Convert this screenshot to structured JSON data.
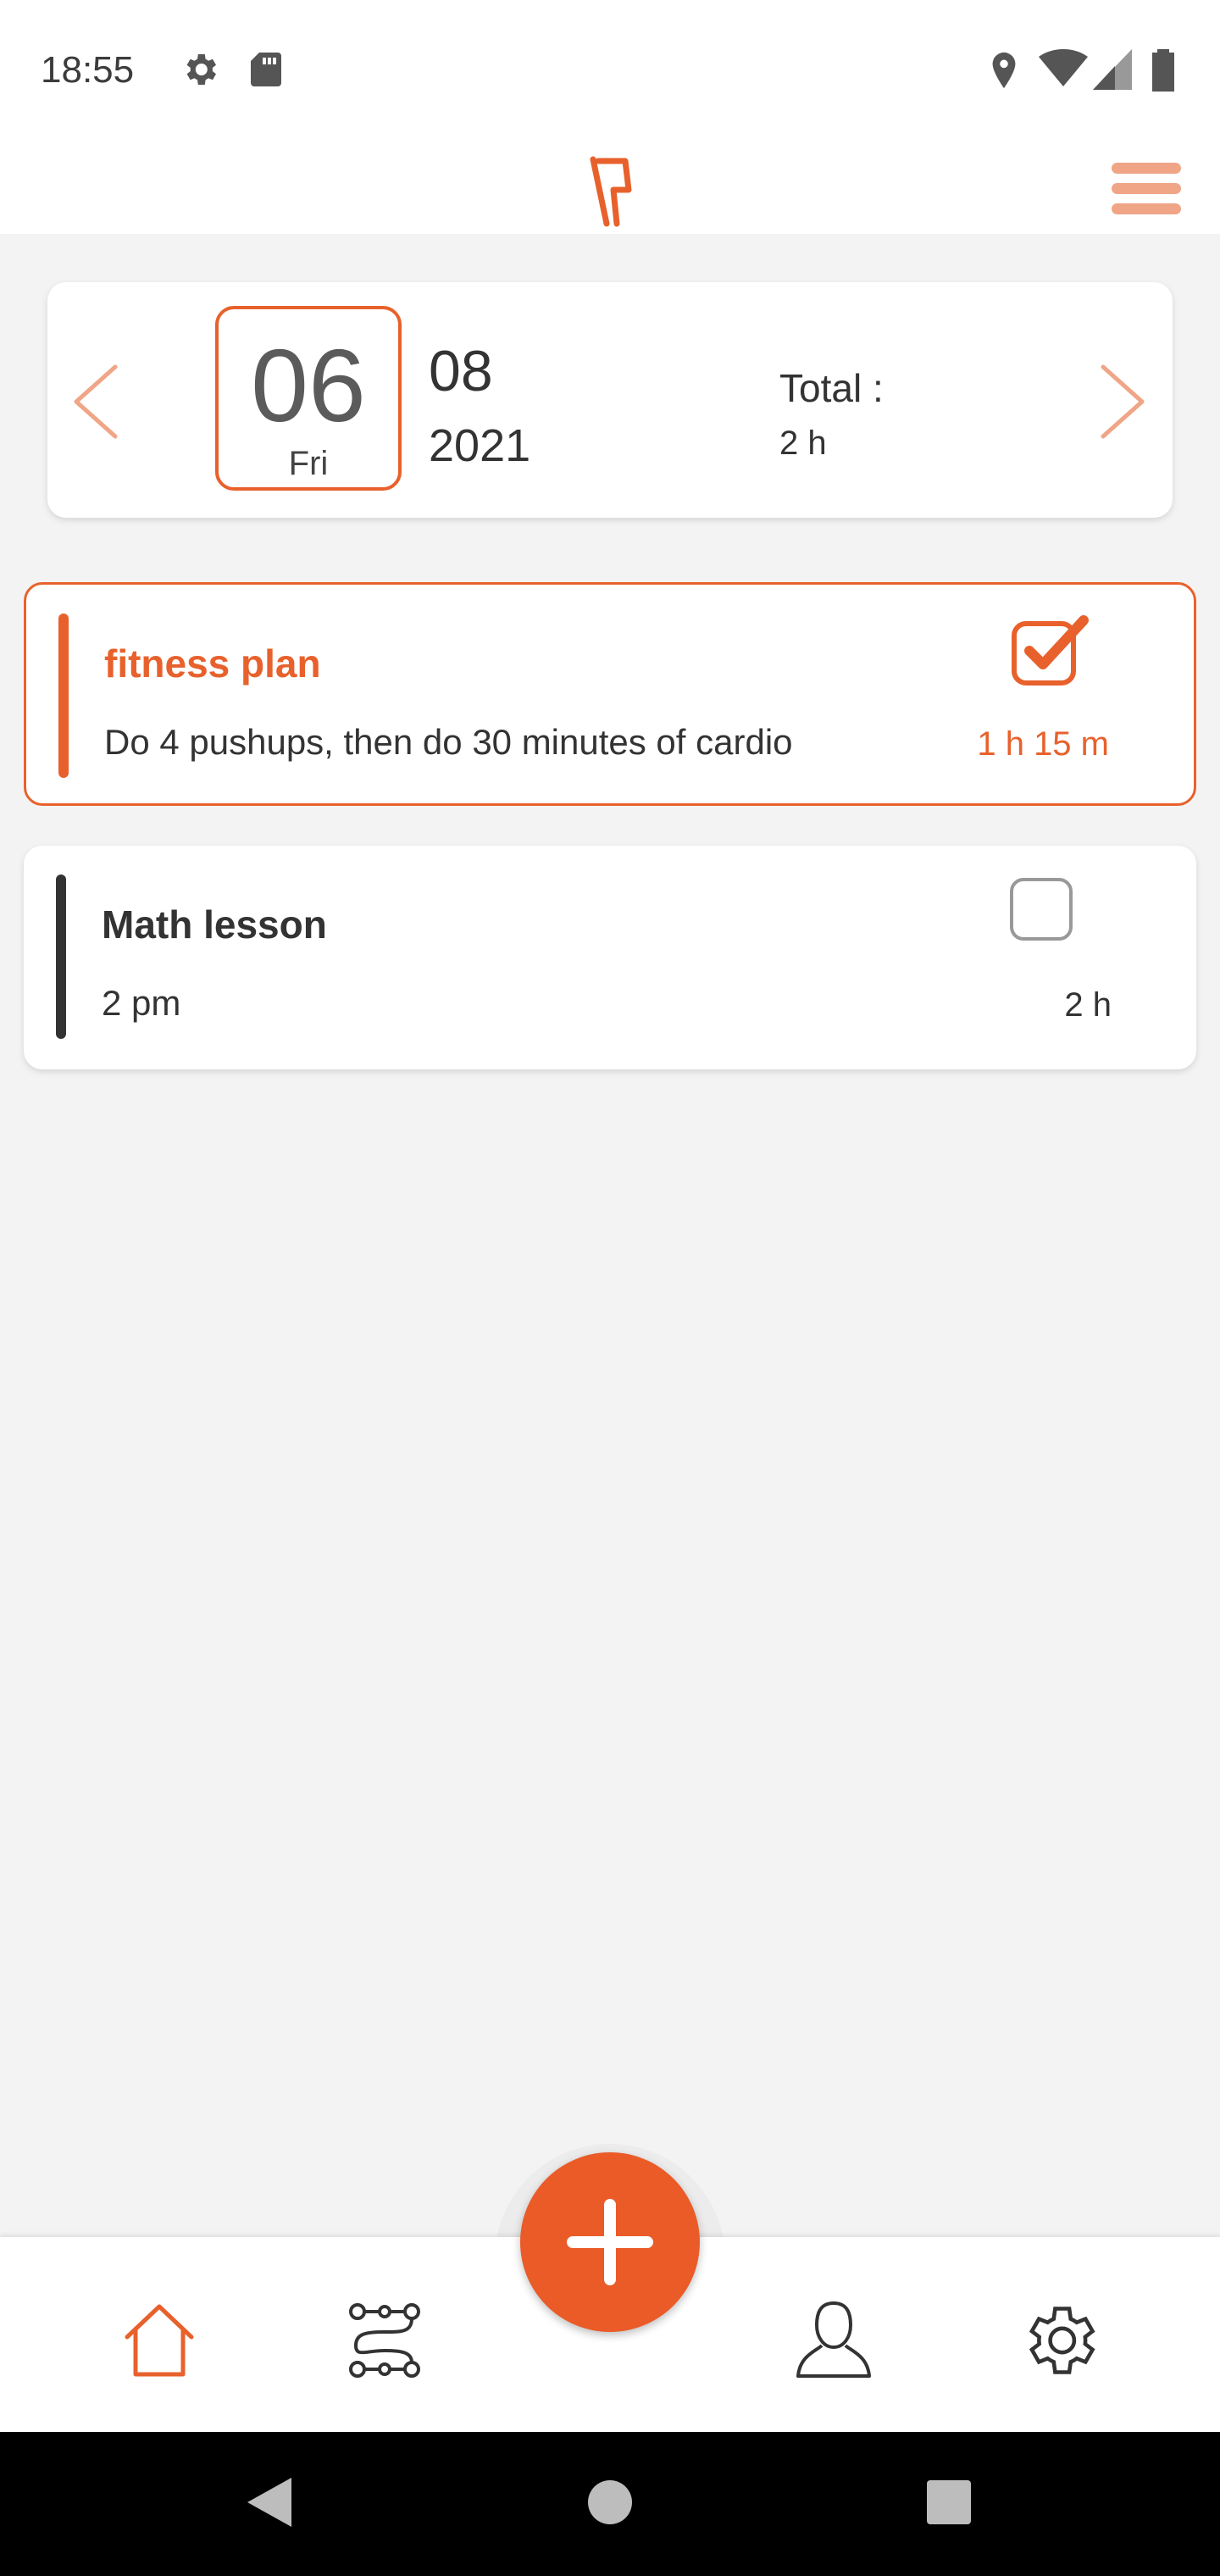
{
  "status_bar": {
    "time": "18:55",
    "left_icons": [
      "gear-icon",
      "sd-card-icon"
    ],
    "right_icons": [
      "location-icon",
      "wifi-icon",
      "signal-icon",
      "battery-icon"
    ]
  },
  "header": {
    "logo": "app-logo",
    "menu_icon": "hamburger-menu-icon"
  },
  "date_selector": {
    "day_number": "06",
    "day_name": "Fri",
    "month": "08",
    "year": "2021",
    "total_label": "Total :",
    "total_value": "2 h",
    "prev_icon": "chevron-left-icon",
    "next_icon": "chevron-right-icon"
  },
  "tasks": [
    {
      "title": "fitness plan",
      "description": "Do 4 pushups, then do 30 minutes of cardio",
      "duration": "1 h 15 m",
      "completed": true,
      "accent_color": "#e8612c"
    },
    {
      "title": "Math lesson",
      "description": "2 pm",
      "duration": "2 h",
      "completed": false,
      "accent_color": "#333333"
    }
  ],
  "bottom_nav": {
    "items": [
      "home-icon",
      "routes-icon",
      "add-icon",
      "profile-icon",
      "settings-icon"
    ],
    "active": "home-icon"
  },
  "colors": {
    "accent": "#e8612c",
    "accent_light": "#f0a587",
    "background": "#f3f3f3",
    "text": "#333333"
  }
}
